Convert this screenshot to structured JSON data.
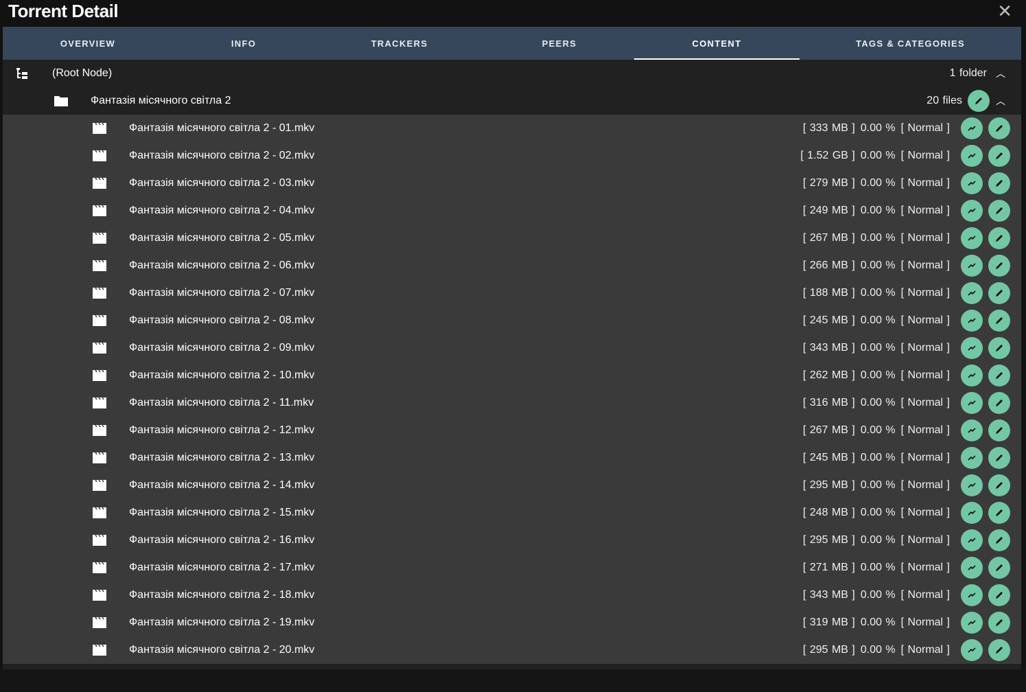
{
  "window": {
    "title": "Torrent Detail",
    "close_icon": "close-icon"
  },
  "tabs": [
    {
      "label": "OVERVIEW"
    },
    {
      "label": "INFO"
    },
    {
      "label": "TRACKERS"
    },
    {
      "label": "PEERS"
    },
    {
      "label": "CONTENT",
      "active": true
    },
    {
      "label": "TAGS & CATEGORIES"
    }
  ],
  "root": {
    "label": "(Root Node)",
    "count": "1 folder"
  },
  "folder": {
    "label": "Фантазія місячного світла 2",
    "count": "20 files"
  },
  "colors": {
    "accent": "#72c8a4",
    "tabbar": "#36475b"
  },
  "files": [
    {
      "name": "Фантазія місячного світла 2 - 01.mkv",
      "size": "[ 333 MB ]",
      "progress": "0.00 %",
      "priority": "[ Normal ]"
    },
    {
      "name": "Фантазія місячного світла 2 - 02.mkv",
      "size": "[ 1.52 GB ]",
      "progress": "0.00 %",
      "priority": "[ Normal ]"
    },
    {
      "name": "Фантазія місячного світла 2 - 03.mkv",
      "size": "[ 279 MB ]",
      "progress": "0.00 %",
      "priority": "[ Normal ]"
    },
    {
      "name": "Фантазія місячного світла 2 - 04.mkv",
      "size": "[ 249 MB ]",
      "progress": "0.00 %",
      "priority": "[ Normal ]"
    },
    {
      "name": "Фантазія місячного світла 2 - 05.mkv",
      "size": "[ 267 MB ]",
      "progress": "0.00 %",
      "priority": "[ Normal ]"
    },
    {
      "name": "Фантазія місячного світла 2 - 06.mkv",
      "size": "[ 266 MB ]",
      "progress": "0.00 %",
      "priority": "[ Normal ]"
    },
    {
      "name": "Фантазія місячного світла 2 - 07.mkv",
      "size": "[ 188 MB ]",
      "progress": "0.00 %",
      "priority": "[ Normal ]"
    },
    {
      "name": "Фантазія місячного світла 2 - 08.mkv",
      "size": "[ 245 MB ]",
      "progress": "0.00 %",
      "priority": "[ Normal ]"
    },
    {
      "name": "Фантазія місячного світла 2 - 09.mkv",
      "size": "[ 343 MB ]",
      "progress": "0.00 %",
      "priority": "[ Normal ]"
    },
    {
      "name": "Фантазія місячного світла 2 - 10.mkv",
      "size": "[ 262 MB ]",
      "progress": "0.00 %",
      "priority": "[ Normal ]"
    },
    {
      "name": "Фантазія місячного світла 2 - 11.mkv",
      "size": "[ 316 MB ]",
      "progress": "0.00 %",
      "priority": "[ Normal ]"
    },
    {
      "name": "Фантазія місячного світла 2 - 12.mkv",
      "size": "[ 267 MB ]",
      "progress": "0.00 %",
      "priority": "[ Normal ]"
    },
    {
      "name": "Фантазія місячного світла 2 - 13.mkv",
      "size": "[ 245 MB ]",
      "progress": "0.00 %",
      "priority": "[ Normal ]"
    },
    {
      "name": "Фантазія місячного світла 2 - 14.mkv",
      "size": "[ 295 MB ]",
      "progress": "0.00 %",
      "priority": "[ Normal ]"
    },
    {
      "name": "Фантазія місячного світла 2 - 15.mkv",
      "size": "[ 248 MB ]",
      "progress": "0.00 %",
      "priority": "[ Normal ]"
    },
    {
      "name": "Фантазія місячного світла 2 - 16.mkv",
      "size": "[ 295 MB ]",
      "progress": "0.00 %",
      "priority": "[ Normal ]"
    },
    {
      "name": "Фантазія місячного світла 2 - 17.mkv",
      "size": "[ 271 MB ]",
      "progress": "0.00 %",
      "priority": "[ Normal ]"
    },
    {
      "name": "Фантазія місячного світла 2 - 18.mkv",
      "size": "[ 343 MB ]",
      "progress": "0.00 %",
      "priority": "[ Normal ]"
    },
    {
      "name": "Фантазія місячного світла 2 - 19.mkv",
      "size": "[ 319 MB ]",
      "progress": "0.00 %",
      "priority": "[ Normal ]"
    },
    {
      "name": "Фантазія місячного світла 2 - 20.mkv",
      "size": "[ 295 MB ]",
      "progress": "0.00 %",
      "priority": "[ Normal ]"
    }
  ]
}
